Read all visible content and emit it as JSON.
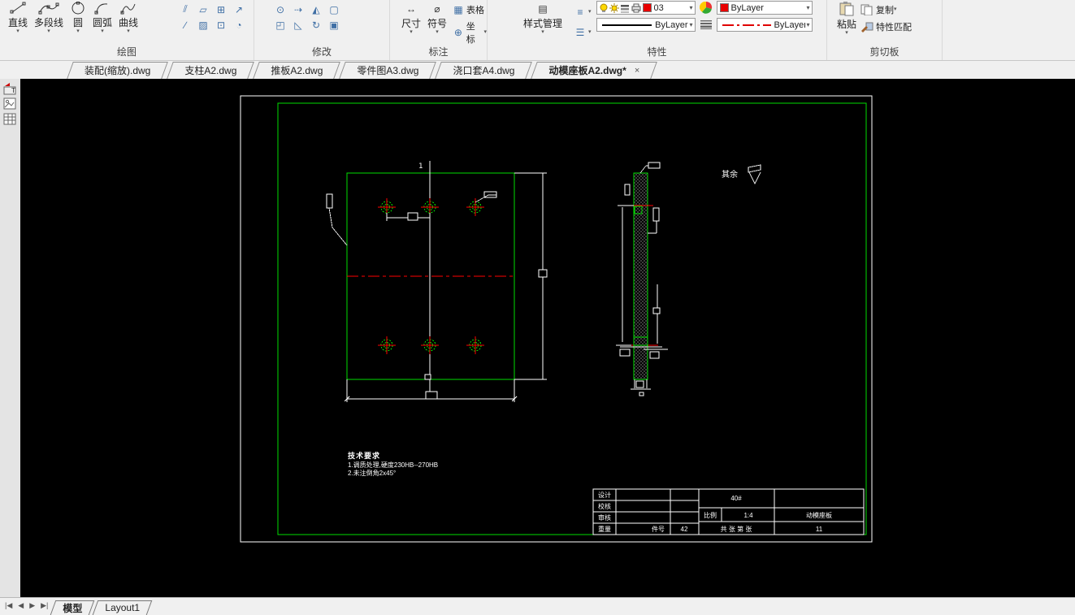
{
  "ribbon": {
    "draw": {
      "label": "绘图",
      "line": "直线",
      "polyline": "多段线",
      "circle": "圆",
      "arc": "圆弧",
      "curve": "曲线"
    },
    "modify": {
      "label": "修改"
    },
    "annotate": {
      "label": "标注",
      "dim": "尺寸",
      "symbol": "符号",
      "table": "表格",
      "coord": "坐标"
    },
    "properties": {
      "label": "特性",
      "style": "样式管理",
      "layer_name": "03",
      "color_value": "ByLayer",
      "linetype_value": "ByLayer",
      "linetype2_value": "ByLayer"
    },
    "clipboard": {
      "label": "剪切板",
      "paste": "粘贴",
      "copy": "复制",
      "match": "特性匹配"
    }
  },
  "tabs": {
    "items": [
      "装配(缩放).dwg",
      "支柱A2.dwg",
      "推板A2.dwg",
      "零件图A3.dwg",
      "浇口套A4.dwg",
      "动模座板A2.dwg*"
    ],
    "close": "×"
  },
  "statusbar": {
    "nav_first": "|◀",
    "nav_prev": "◀",
    "nav_next": "▶",
    "nav_last": "▶|",
    "model": "模型",
    "layout": "Layout1"
  },
  "drawing": {
    "section_mark": "1",
    "surface_note": "其余",
    "tech_title": "技术要求",
    "tech_line1": "1.调质处理,硬度230HB--270HB",
    "tech_line2": "2.未注倒角2x45°",
    "titleblock": {
      "design": "设计",
      "check": "校核",
      "audit": "审核",
      "weight": "重量",
      "part_no_label": "件号",
      "part_no": "42",
      "material": "40#",
      "scale_label": "比例",
      "scale": "1:4",
      "sheet_note": "共  张  第  张",
      "part_name": "动模座板",
      "drawing_no": "11"
    }
  },
  "colors": {
    "cad_green": "#00dd00",
    "cad_red": "#ff0000",
    "canvas": "#000000",
    "layer_swatch": "#e80000"
  }
}
